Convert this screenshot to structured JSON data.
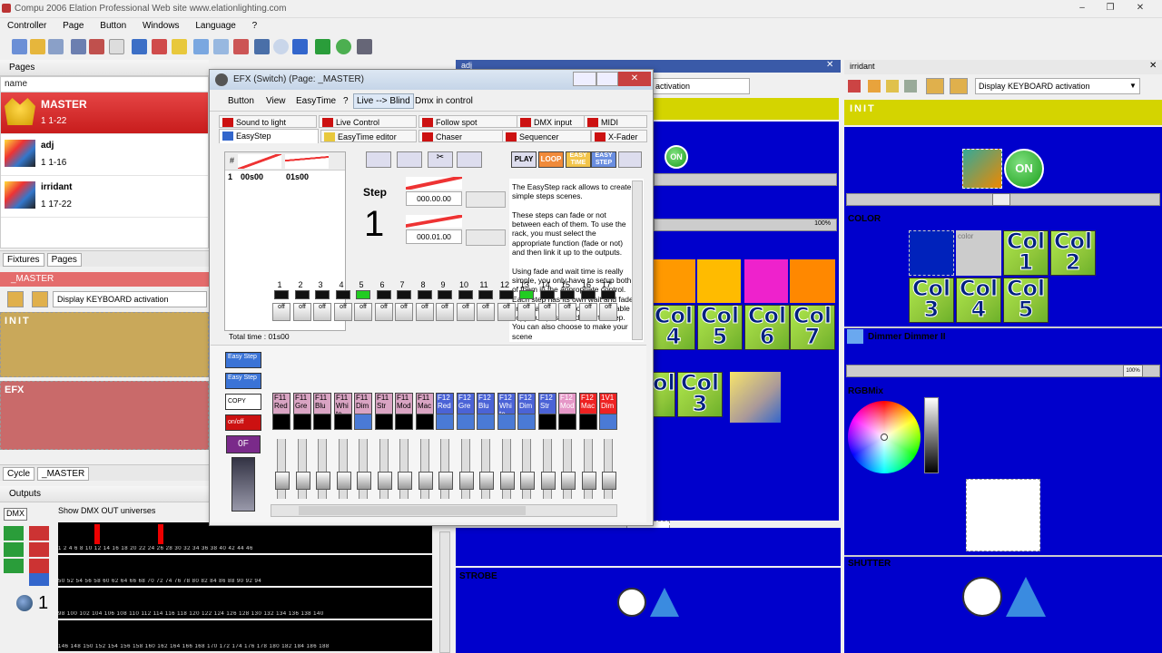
{
  "app": {
    "title": "Compu 2006    Elation Professional    Web site  www.elationlighting.com",
    "controls": [
      "–",
      "❐",
      "✕"
    ]
  },
  "menu": [
    "Controller",
    "Page",
    "Button",
    "Windows",
    "Language",
    "?"
  ],
  "pages_panel": {
    "header": "Pages",
    "column": "name",
    "items": [
      {
        "name": "MASTER",
        "info": "1  1-22"
      },
      {
        "name": "adj",
        "info": "1  1-16"
      },
      {
        "name": "irridant",
        "info": "1  17-22"
      }
    ],
    "tabs": [
      "Fixtures",
      "Pages"
    ]
  },
  "master_panel": {
    "title": "_MASTER",
    "keyboard": "Display KEYBOARD activation",
    "init": "INIT",
    "efx": "EFX",
    "tabs": [
      "Cycle",
      "_MASTER"
    ]
  },
  "outputs": {
    "header": "Outputs",
    "dmx": "DMX",
    "show": "Show DMX OUT universes",
    "universe": "1",
    "row1": "1  2  4  6  8  10  12  14  16  18  20  22  24  26  28  30  32  34  36  38  40  42  44  46",
    "row2": "50  52  54  56  58  60  62  64  66  68  70  72  74  76  78  80  82  84  86  88  90  92  94",
    "row3": "98  100  102  104  106  108  110  112  114  116  118  120  122  124  126  128  130  132  134  136  138  140",
    "row4": "146  148  150  152  154  156  158  160  162  164  166  168  170  172  174  176  178  180  182  184  186  188"
  },
  "adj_panel": {
    "title": "adj",
    "keyboard": "activation",
    "on": "ON",
    "pct": "100%",
    "cols": [
      "Col\n4",
      "Col\n5",
      "Col\n6",
      "Col\n7"
    ],
    "col2": [
      "ol\n",
      "Col\n3"
    ],
    "strobe": "STROBE"
  },
  "irridant_panel": {
    "title": "irridant",
    "keyboard": "Display KEYBOARD activation",
    "init": "INIT",
    "on": "ON",
    "color": "COLOR",
    "color_cell": "color",
    "cols": [
      "Col\n1",
      "Col\n2",
      "Col\n3",
      "Col\n4",
      "Col\n5"
    ],
    "dimmer": "Dimmer Dimmer II",
    "pct": "100%",
    "rgb": "RGBMix",
    "shutter": "SHUTTER"
  },
  "efx": {
    "title": "EFX  (Switch)  (Page: _MASTER)",
    "menu": [
      "Button",
      "View",
      "EasyTime",
      "?",
      "Live --> Blind",
      "Dmx in control"
    ],
    "tabs_row1": [
      "Sound to light",
      "Live Control",
      "Follow spot",
      "DMX input",
      "MIDI"
    ],
    "tabs_row2": [
      "EasyStep",
      "EasyTime editor",
      "Chaser",
      "Sequencer",
      "X-Fader"
    ],
    "grid_head": "#",
    "grid_row": [
      "1",
      "00s00",
      "01s00"
    ],
    "total": "Total time : 01s00",
    "step_label": "Step",
    "step_num": "1",
    "time1": "000.00.00",
    "time2": "000.01.00",
    "btn_labels": [
      "PLAY",
      "LOOP",
      "EASY TIME",
      "EASY STEP"
    ],
    "help": "The EasyStep rack allows to create simple steps scenes.\n\nThese steps can fade or not between each of them. To use the rack, you must select the appropriate function (fade or not) and then link it up to the outputs.\n\nUsing fade and wait time is really simple, you only have to setup both of them in the appropriate control. Each step has its own wait and fade time. Various function are available : copy, cut, paste and insert a step. You can also choose to make your scene",
    "side_buttons": [
      "Easy Step",
      "Easy Step",
      "COPY",
      "on/off",
      "0F"
    ],
    "channels": [
      "1",
      "2",
      "3",
      "4",
      "5",
      "6",
      "7",
      "8",
      "9",
      "10",
      "11",
      "12",
      "13",
      "14",
      "15",
      "16",
      "17"
    ],
    "off": "off",
    "ch_labels": [
      "F11\nRed",
      "F11\nGre",
      "F11\nBlu",
      "F11\nWhi\nte\nA",
      "F11\nDim",
      "F11\nStr",
      "F11\nMod",
      "F11\nMac",
      "F12\nRed",
      "F12\nGre",
      "F12\nBlu",
      "F12\nWhi\nte\nA",
      "F12\nDim",
      "F12\nStr",
      "F12\nMod",
      "F12\nMac",
      "1V1\nDim"
    ]
  }
}
